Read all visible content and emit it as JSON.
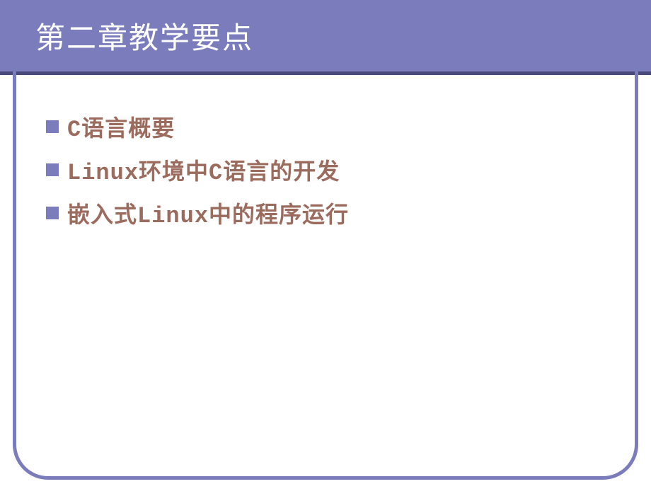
{
  "header": {
    "title": "第二章教学要点"
  },
  "bullets": [
    {
      "text": "C语言概要"
    },
    {
      "text": "Linux环境中C语言的开发"
    },
    {
      "text": "嵌入式Linux中的程序运行"
    }
  ]
}
